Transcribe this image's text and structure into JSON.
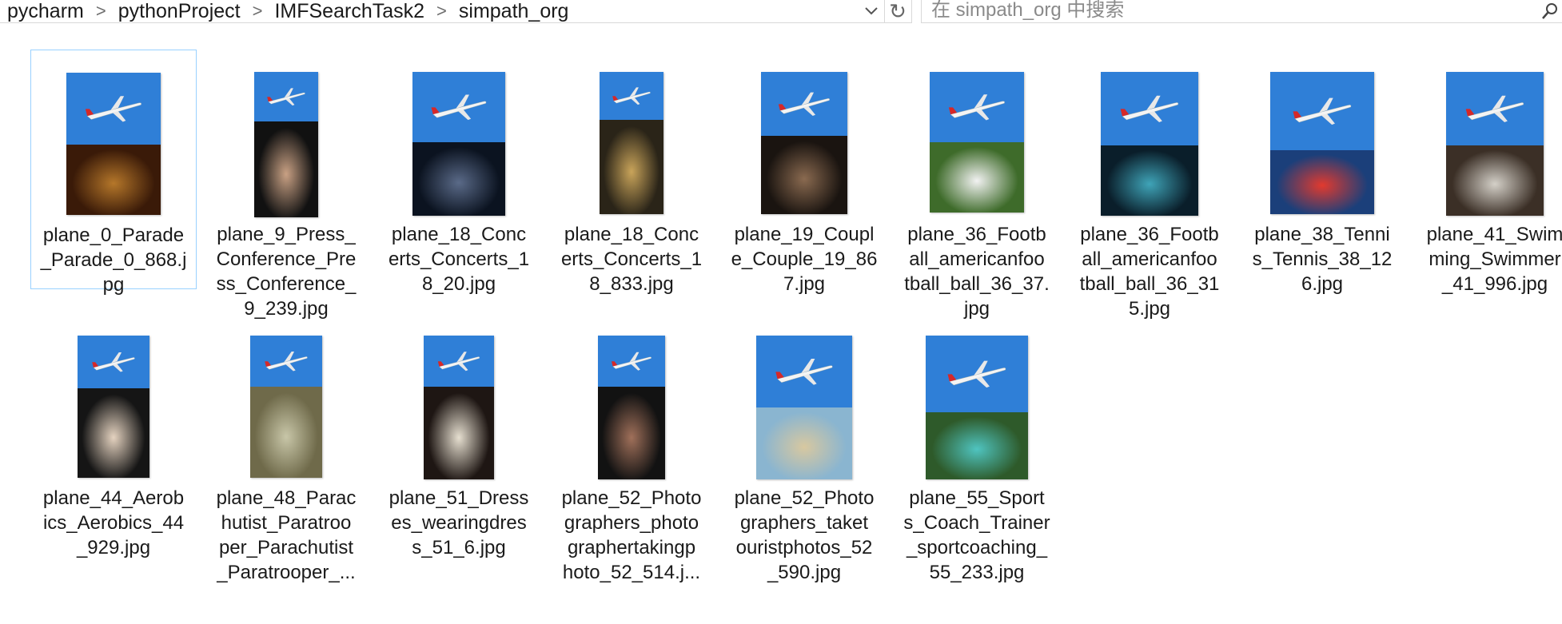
{
  "breadcrumb": {
    "items": [
      "pycharm",
      "pythonProject",
      "IMFSearchTask2",
      "simpath_org"
    ],
    "separator": ">"
  },
  "toolbar": {
    "dropdown_icon": "chevron-down-icon",
    "refresh_icon": "refresh-icon"
  },
  "search": {
    "placeholder": "在 simpath_org 中搜索",
    "icon": "search-icon"
  },
  "colors": {
    "sky": "#2f7fd7",
    "selection_border": "#99d1ff"
  },
  "files": [
    {
      "name": "plane_0_Parade_Parade_0_868.jpg",
      "label": "plane_0_Parade\n_Parade_0_868.j\npg",
      "selected": true
    },
    {
      "name": "plane_9_Press_Conference_Press_Conference_9_239.jpg",
      "label": "plane_9_Press_\nConference_Pre\nss_Conference_\n9_239.jpg"
    },
    {
      "name": "plane_18_Concerts_Concerts_18_20.jpg",
      "label": "plane_18_Conc\nerts_Concerts_1\n8_20.jpg"
    },
    {
      "name": "plane_18_Concerts_Concerts_18_833.jpg",
      "label": "plane_18_Conc\nerts_Concerts_1\n8_833.jpg"
    },
    {
      "name": "plane_19_Couple_Couple_19_867.jpg",
      "label": "plane_19_Coupl\ne_Couple_19_86\n7.jpg"
    },
    {
      "name": "plane_36_Football_americanfootball_ball_36_37.jpg",
      "label": "plane_36_Footb\nall_americanfoo\ntball_ball_36_37.\njpg"
    },
    {
      "name": "plane_36_Football_americanfootball_ball_36_315.jpg",
      "label": "plane_36_Footb\nall_americanfoo\ntball_ball_36_31\n5.jpg"
    },
    {
      "name": "plane_38_Tennis_Tennis_38_126.jpg",
      "label": "plane_38_Tenni\ns_Tennis_38_12\n6.jpg"
    },
    {
      "name": "plane_41_Swimming_Swimmer_41_996.jpg",
      "label": "plane_41_Swim\nming_Swimmer\n_41_996.jpg"
    },
    {
      "name": "plane_44_Aerobics_Aerobics_44_929.jpg",
      "label": "plane_44_Aerob\nics_Aerobics_44\n_929.jpg"
    },
    {
      "name": "plane_48_Parachutist_Paratrooper_Parachutist_Paratrooper_...",
      "label": "plane_48_Parac\nhutist_Paratroo\nper_Parachutist\n_Paratrooper_..."
    },
    {
      "name": "plane_51_Dresses_wearingdresses_51_6.jpg",
      "label": "plane_51_Dress\nes_wearingdres\ns_51_6.jpg"
    },
    {
      "name": "plane_52_Photographers_photographertakingphoto_52_514.j...",
      "label": "plane_52_Photo\ngraphers_photo\ngraphertakingp\nhoto_52_514.j..."
    },
    {
      "name": "plane_52_Photographers_taketouristphotos_52_590.jpg",
      "label": "plane_52_Photo\ngraphers_taket\nouristphotos_52\n_590.jpg"
    },
    {
      "name": "plane_55_Sports_Coach_Trainer_sportcoaching_55_233.jpg",
      "label": "plane_55_Sport\ns_Coach_Trainer\n_sportcoaching_\n55_233.jpg"
    }
  ]
}
